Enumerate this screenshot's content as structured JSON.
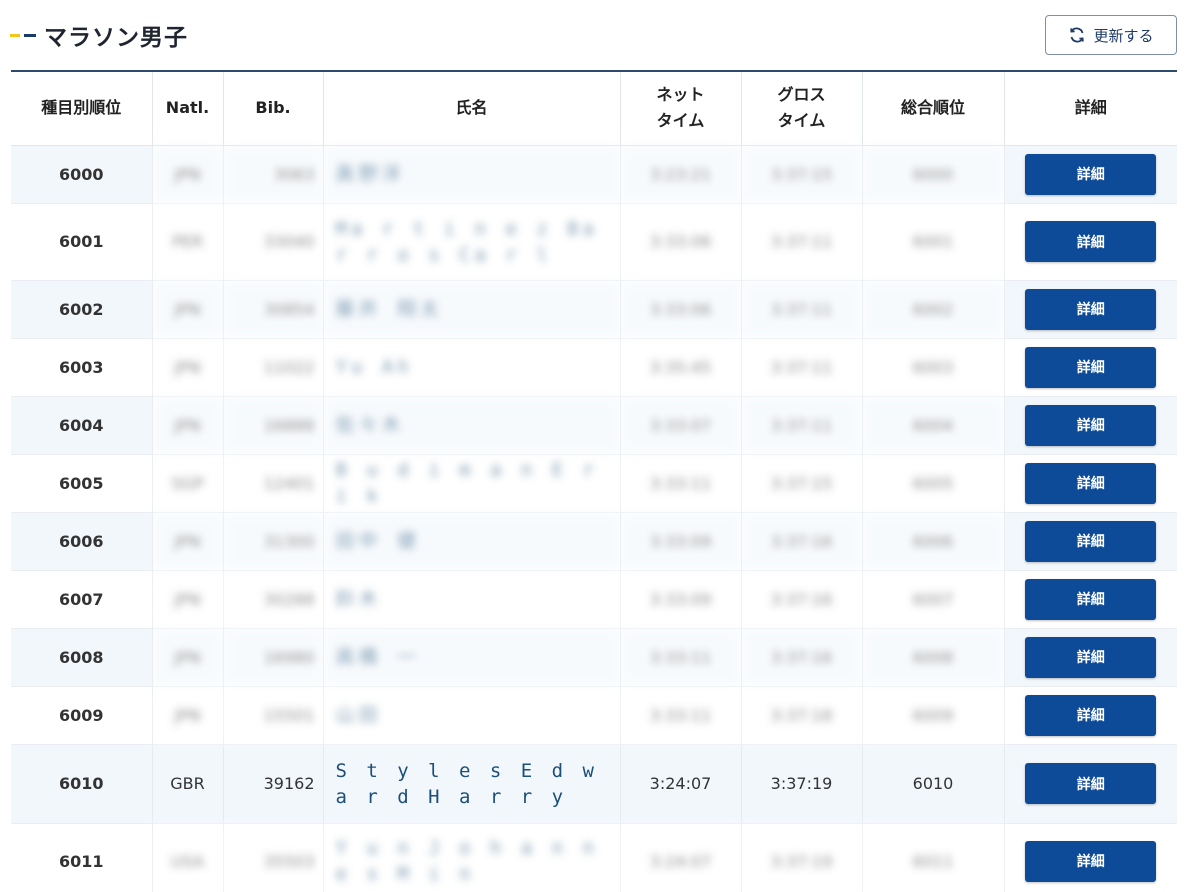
{
  "header": {
    "title": "マラソン男子",
    "refresh_label": "更新する",
    "refresh_icon": "refresh-icon"
  },
  "colors": {
    "accent_yellow": "#f5c518",
    "accent_navy": "#1a3a6b",
    "detail_button": "#0d4a97",
    "row_alt": "#f2f7fc",
    "name_text": "#1b4f7a"
  },
  "table": {
    "headers": {
      "rank": "種目別順位",
      "natl": "Natl.",
      "bib": "Bib.",
      "name": "氏名",
      "net_line1": "ネット",
      "net_line2": "タイム",
      "gross_line1": "グロス",
      "gross_line2": "タイム",
      "overall": "総合順位",
      "detail": "詳細"
    },
    "rows": [
      {
        "rank": "6000",
        "natl": "JPN",
        "bib": "3063",
        "name": "眞野洋",
        "net": "3:23:21",
        "gross": "3:37:15",
        "overall": "6000",
        "detail": "詳細"
      },
      {
        "rank": "6001",
        "natl": "PER",
        "bib": "33040",
        "name": "Ma r t i n e z  Ba r r o s Ca r l",
        "net": "3:33:06",
        "gross": "3:37:11",
        "overall": "6001",
        "detail": "詳細"
      },
      {
        "rank": "6002",
        "natl": "JPN",
        "bib": "30854",
        "name": "藤井 翔太",
        "net": "3:33:06",
        "gross": "3:37:11",
        "overall": "6002",
        "detail": "詳細"
      },
      {
        "rank": "6003",
        "natl": "JPN",
        "bib": "11022",
        "name": "Yu Ah",
        "net": "3:35:45",
        "gross": "3:37:11",
        "overall": "6003",
        "detail": "詳細"
      },
      {
        "rank": "6004",
        "natl": "JPN",
        "bib": "16888",
        "name": "佐々木",
        "net": "3:33:07",
        "gross": "3:37:11",
        "overall": "6004",
        "detail": "詳細"
      },
      {
        "rank": "6005",
        "natl": "SGP",
        "bib": "12401",
        "name": "B u d i m a n E r i k",
        "net": "3:33:11",
        "gross": "3:37:15",
        "overall": "6005",
        "detail": "詳細"
      },
      {
        "rank": "6006",
        "natl": "JPN",
        "bib": "31300",
        "name": "田中 健",
        "net": "3:33:09",
        "gross": "3:37:16",
        "overall": "6006",
        "detail": "詳細"
      },
      {
        "rank": "6007",
        "natl": "JPN",
        "bib": "30288",
        "name": "鈴木",
        "net": "3:33:09",
        "gross": "3:37:16",
        "overall": "6007",
        "detail": "詳細"
      },
      {
        "rank": "6008",
        "natl": "JPN",
        "bib": "16980",
        "name": "高橋 一",
        "net": "3:33:11",
        "gross": "3:37:16",
        "overall": "6008",
        "detail": "詳細"
      },
      {
        "rank": "6009",
        "natl": "JPN",
        "bib": "15501",
        "name": "山田",
        "net": "3:33:11",
        "gross": "3:37:18",
        "overall": "6009",
        "detail": "詳細"
      },
      {
        "rank": "6010",
        "natl": "GBR",
        "bib": "39162",
        "name": "S t y l e s  E d w a r d H a r r y",
        "net": "3:24:07",
        "gross": "3:37:19",
        "overall": "6010",
        "detail": "詳細"
      },
      {
        "rank": "6011",
        "natl": "USA",
        "bib": "35503",
        "name": "Y u n  J o h a n n e s M i n",
        "net": "3:24:07",
        "gross": "3:37:19",
        "overall": "6011",
        "detail": "詳細"
      }
    ]
  }
}
